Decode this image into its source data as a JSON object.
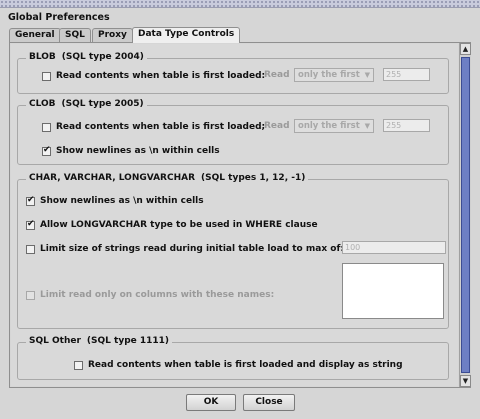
{
  "dialog": {
    "title": "Global Preferences"
  },
  "tabs": [
    {
      "label": "General"
    },
    {
      "label": "SQL"
    },
    {
      "label": "Proxy"
    },
    {
      "label": "Data Type Controls",
      "active": true
    }
  ],
  "blob": {
    "title": "BLOB",
    "sql_type": "(SQL type 2004)",
    "read_on_load": {
      "label": "Read contents when table is first loaded:",
      "checked": false
    },
    "read_label": "Read",
    "read_mode": "only the first",
    "read_limit": "255"
  },
  "clob": {
    "title": "CLOB",
    "sql_type": "(SQL type 2005)",
    "read_on_load": {
      "label": "Read contents when table is first loaded;",
      "checked": false
    },
    "read_label": "Read",
    "read_mode": "only the first",
    "read_limit": "255",
    "show_newlines": {
      "label": "Show newlines as \\n within cells",
      "checked": true
    }
  },
  "char": {
    "title": "CHAR, VARCHAR, LONGVARCHAR",
    "sql_type": "(SQL types 1, 12, -1)",
    "show_newlines": {
      "label": "Show newlines as \\n within cells",
      "checked": true
    },
    "allow_longvarchar": {
      "label": "Allow LONGVARCHAR type to be used in WHERE clause",
      "checked": true
    },
    "limit_size": {
      "label": "Limit size of strings read during initial table load to max of:",
      "checked": false
    },
    "limit_value": "100",
    "limit_columns": {
      "label": "Limit read only on columns with these names:",
      "checked": false
    }
  },
  "sql_other": {
    "title": "SQL Other",
    "sql_type": "(SQL type 1111)",
    "read_as_string": {
      "label": "Read contents when table is first loaded and display as string",
      "checked": false
    }
  },
  "buttons": {
    "ok": "OK",
    "close": "Close"
  },
  "scrollbar": {
    "up_icon": "▲",
    "down_icon": "▼"
  },
  "icons": {
    "combo_arrow": "▼"
  },
  "colors": {
    "scroll_thumb": "#6d7fc4",
    "background": "#d6d6d6"
  }
}
